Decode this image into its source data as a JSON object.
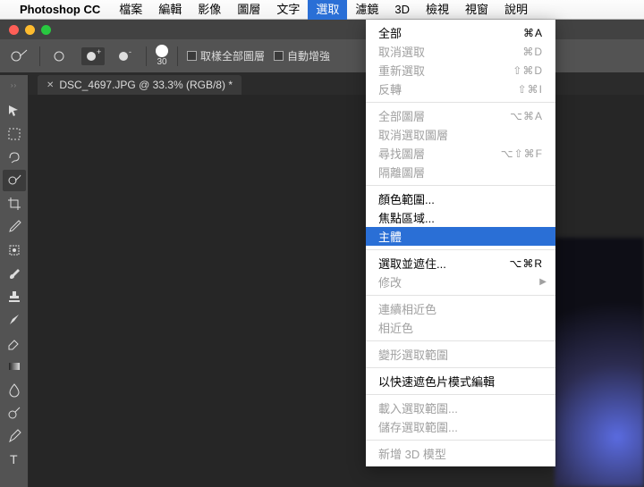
{
  "menubar": {
    "appname": "Photoshop CC",
    "items": [
      "檔案",
      "編輯",
      "影像",
      "圖層",
      "文字",
      "選取",
      "濾鏡",
      "3D",
      "檢視",
      "視窗",
      "說明"
    ],
    "active_index": 5
  },
  "optionsbar": {
    "brush_size": "30",
    "chk1": "取樣全部圖層",
    "chk2": "自動增強"
  },
  "tab": {
    "title": "DSC_4697.JPG @ 33.3% (RGB/8) *"
  },
  "dropdown": {
    "groups": [
      [
        {
          "label": "全部",
          "sc": "⌘A",
          "disabled": false
        },
        {
          "label": "取消選取",
          "sc": "⌘D",
          "disabled": true
        },
        {
          "label": "重新選取",
          "sc": "⇧⌘D",
          "disabled": true
        },
        {
          "label": "反轉",
          "sc": "⇧⌘I",
          "disabled": true
        }
      ],
      [
        {
          "label": "全部圖層",
          "sc": "⌥⌘A",
          "disabled": true
        },
        {
          "label": "取消選取圖層",
          "disabled": true
        },
        {
          "label": "尋找圖層",
          "sc": "⌥⇧⌘F",
          "disabled": true
        },
        {
          "label": "隔離圖層",
          "disabled": true
        }
      ],
      [
        {
          "label": "顏色範圍...",
          "disabled": false
        },
        {
          "label": "焦點區域...",
          "disabled": false
        },
        {
          "label": "主體",
          "disabled": false,
          "hl": true
        }
      ],
      [
        {
          "label": "選取並遮住...",
          "sc": "⌥⌘R",
          "disabled": false
        },
        {
          "label": "修改",
          "disabled": true,
          "arrow": true
        }
      ],
      [
        {
          "label": "連續相近色",
          "disabled": true
        },
        {
          "label": "相近色",
          "disabled": true
        }
      ],
      [
        {
          "label": "變形選取範圍",
          "disabled": true
        }
      ],
      [
        {
          "label": "以快速遮色片模式編輯",
          "disabled": false
        }
      ],
      [
        {
          "label": "載入選取範圍...",
          "disabled": true
        },
        {
          "label": "儲存選取範圍...",
          "disabled": true
        }
      ],
      [
        {
          "label": "新增 3D 模型",
          "disabled": true
        }
      ]
    ]
  },
  "tools": [
    "move",
    "marquee",
    "lasso",
    "quick-select",
    "crop",
    "eyedropper",
    "heal",
    "brush",
    "stamp",
    "history",
    "eraser",
    "gradient",
    "blur",
    "dodge",
    "pen",
    "type"
  ]
}
